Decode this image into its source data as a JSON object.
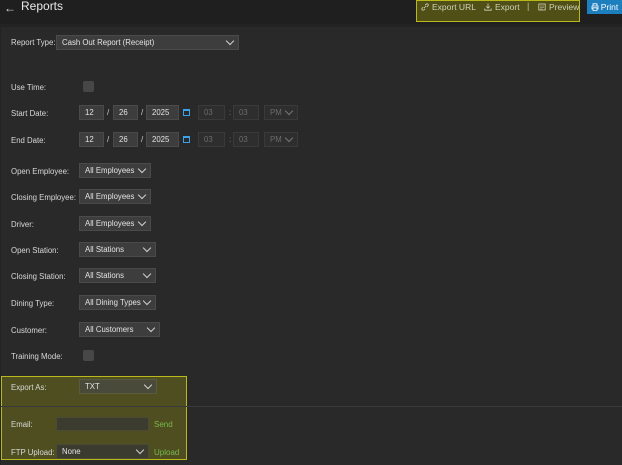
{
  "header": {
    "title": "Reports",
    "export_url": "Export URL",
    "export": "Export",
    "separator": "|",
    "preview": "Preview",
    "print": "Print"
  },
  "icons": {
    "back": "arrow-left-icon",
    "export_url": "link-icon",
    "export": "download-icon",
    "preview": "preview-icon",
    "print": "printer-icon",
    "calendar": "calendar-icon"
  },
  "colors": {
    "accent": "#1e7fbf",
    "calendar": "#3ca3e8",
    "highlight": "#b9b91c",
    "link_green": "#79b84d"
  },
  "form": {
    "report_type": {
      "label": "Report Type:",
      "value": "Cash Out Report (Receipt)"
    },
    "use_time": {
      "label": "Use Time:"
    },
    "start_date": {
      "label": "Start Date:",
      "month": "12",
      "day": "26",
      "year": "2025",
      "hour": "03",
      "minute": "03",
      "ampm": "PM"
    },
    "end_date": {
      "label": "End Date:",
      "month": "12",
      "day": "26",
      "year": "2025",
      "hour": "03",
      "minute": "03",
      "ampm": "PM"
    },
    "date_sep": "/",
    "time_sep": ":",
    "open_employee": {
      "label": "Open Employee:",
      "value": "All Employees"
    },
    "closing_employee": {
      "label": "Closing Employee:",
      "value": "All Employees"
    },
    "driver": {
      "label": "Driver:",
      "value": "All Employees"
    },
    "open_station": {
      "label": "Open Station:",
      "value": "All Stations"
    },
    "closing_station": {
      "label": "Closing Station:",
      "value": "All Stations"
    },
    "dining_type": {
      "label": "Dining Type:",
      "value": "All Dining Types"
    },
    "customer": {
      "label": "Customer:",
      "value": "All Customers"
    },
    "training_mode": {
      "label": "Training Mode:"
    },
    "export_as": {
      "label": "Export As:",
      "value": "TXT"
    },
    "email": {
      "label": "Email:",
      "value": "",
      "action": "Send"
    },
    "ftp_upload": {
      "label": "FTP Upload:",
      "value": "None",
      "action": "Upload"
    }
  }
}
